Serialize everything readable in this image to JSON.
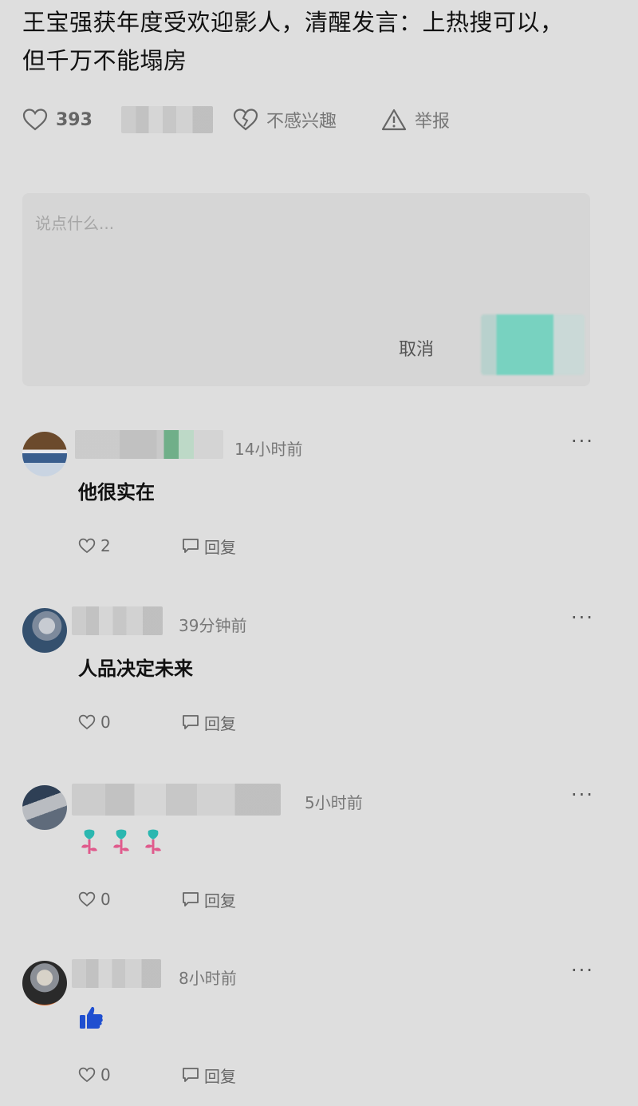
{
  "post": {
    "title": "王宝强获年度受欢迎影人，清醒发言：上热搜可以，但千万不能塌房",
    "likes": "393",
    "not_interested_label": "不感兴趣",
    "report_label": "举报"
  },
  "composer": {
    "placeholder": "说点什么...",
    "cancel_label": "取消"
  },
  "comments": [
    {
      "time": "14小时前",
      "text": "他很实在",
      "likes": "2",
      "reply_label": "回复"
    },
    {
      "time": "39分钟前",
      "text": "人品决定未来",
      "likes": "0",
      "reply_label": "回复"
    },
    {
      "time": "5小时前",
      "emoji": [
        "rose-icon",
        "rose-icon",
        "rose-icon"
      ],
      "likes": "0",
      "reply_label": "回复"
    },
    {
      "time": "8小时前",
      "emoji": [
        "thumbs-up-icon"
      ],
      "likes": "0",
      "reply_label": "回复"
    }
  ],
  "colors": {
    "background": "#dedede",
    "composer_bg": "#d6d6d6",
    "submit_accent": "#6fd2be",
    "thumb_blue": "#1f4fd0",
    "rose_pink": "#e05a8c",
    "rose_teal": "#2bb7b0"
  }
}
